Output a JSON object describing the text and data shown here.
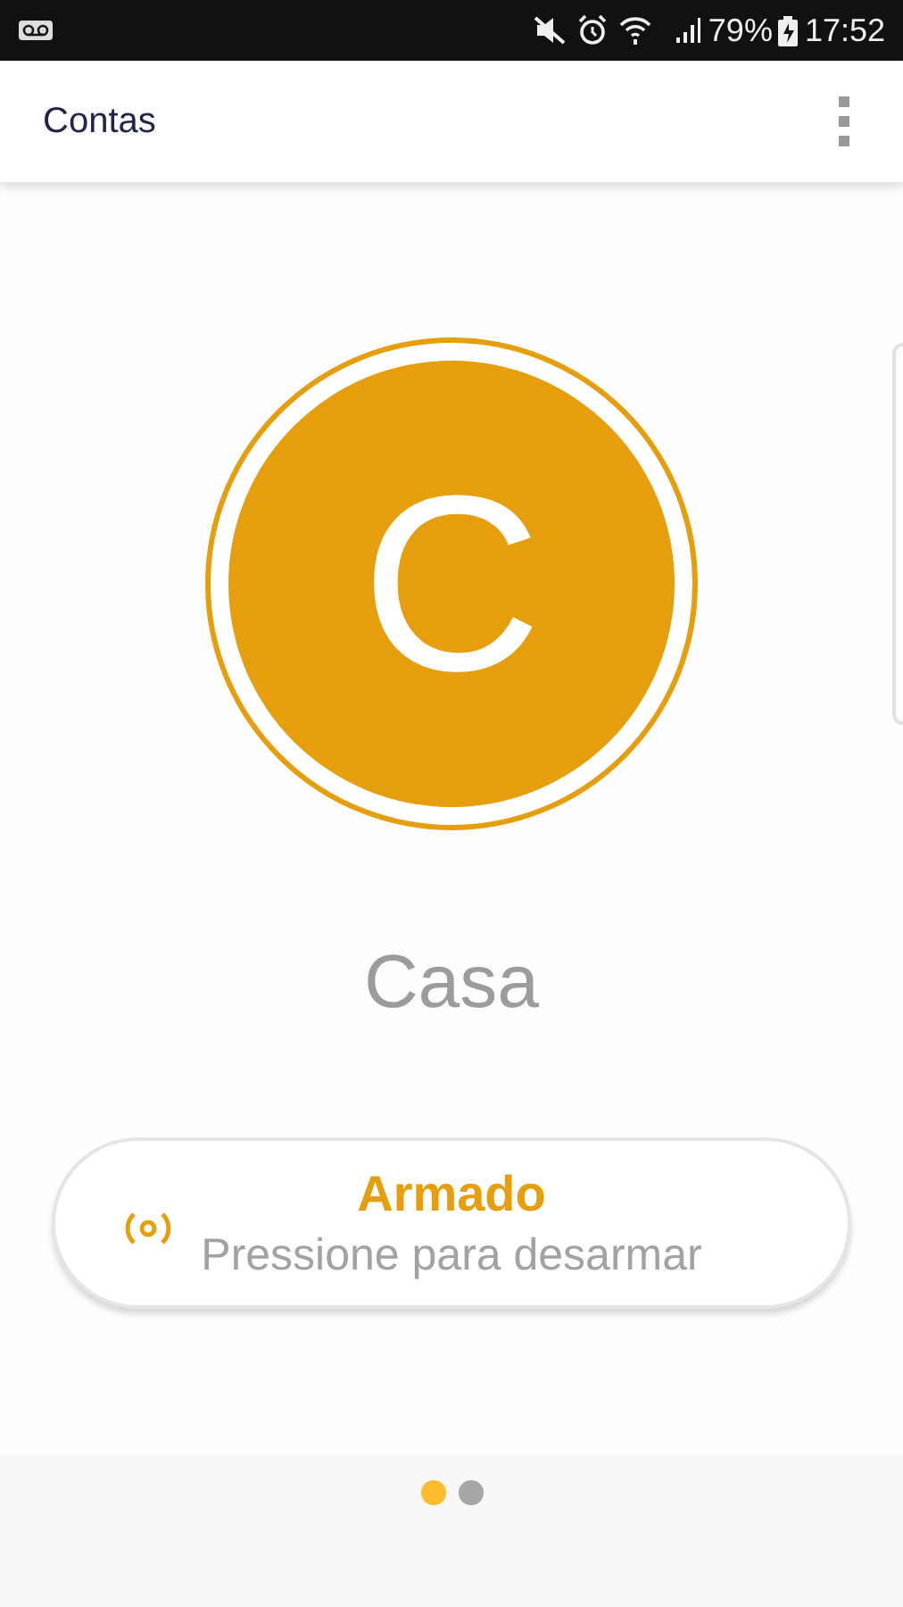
{
  "status_bar": {
    "battery": "79%",
    "time": "17:52"
  },
  "app_bar": {
    "title": "Contas"
  },
  "account": {
    "initial": "C",
    "name": "Casa"
  },
  "alarm_button": {
    "title": "Armado",
    "subtitle": "Pressione para desarmar"
  },
  "pager": [
    {
      "selected": true
    },
    {
      "selected": false
    }
  ]
}
